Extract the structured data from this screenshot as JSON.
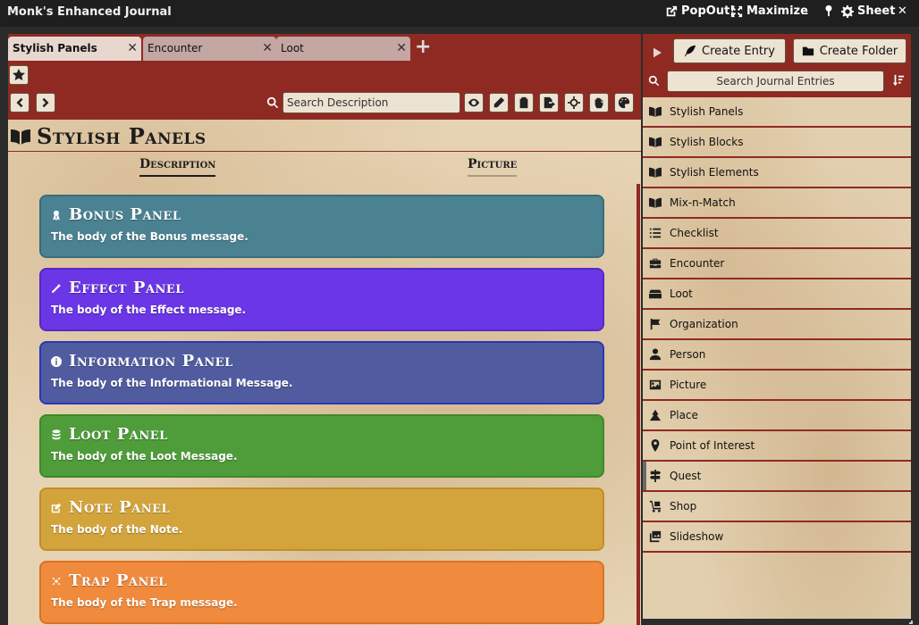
{
  "window": {
    "title": "Monk's Enhanced Journal",
    "buttons": {
      "popout": "PopOut!",
      "maximize": "Maximize",
      "minimize": "_",
      "sheet": "Sheet",
      "close": "✕"
    }
  },
  "tabs": [
    {
      "label": "Stylish Panels",
      "active": true
    },
    {
      "label": "Encounter",
      "active": false
    },
    {
      "label": "Loot",
      "active": false
    }
  ],
  "search": {
    "placeholder": "Search Description"
  },
  "entry": {
    "title": "Stylish Panels"
  },
  "subtabs": {
    "description": "Description",
    "picture": "Picture"
  },
  "panels": [
    {
      "title": "Bonus Panel",
      "body": "The body of the Bonus message.",
      "color": "#4a8292",
      "border": "#396d7a",
      "icon": "award-icon"
    },
    {
      "title": "Effect Panel",
      "body": "The body of the Effect message.",
      "color": "#6a36e6",
      "border": "#5529c7",
      "icon": "magic-wand-icon"
    },
    {
      "title": "Information Panel",
      "body": "The body of the Informational Message.",
      "color": "#515ca0",
      "border": "#2a36b8",
      "icon": "info-icon"
    },
    {
      "title": "Loot Panel",
      "body": "The body of the Loot Message.",
      "color": "#4f9c3a",
      "border": "#3d8a2a",
      "icon": "coins-icon"
    },
    {
      "title": "Note Panel",
      "body": "The body of the Note.",
      "color": "#d4a43c",
      "border": "#c08e26",
      "icon": "note-icon"
    },
    {
      "title": "Trap Panel",
      "body": "The body of the Trap message.",
      "color": "#f08a3c",
      "border": "#db7224",
      "icon": "crosshair-x-icon"
    }
  ],
  "sidebar": {
    "create_entry": "Create Entry",
    "create_folder": "Create Folder",
    "search_placeholder": "Search Journal Entries",
    "items": [
      {
        "label": "Stylish Panels",
        "icon": "book-open-icon"
      },
      {
        "label": "Stylish Blocks",
        "icon": "book-open-icon"
      },
      {
        "label": "Stylish Elements",
        "icon": "book-open-icon"
      },
      {
        "label": "Mix-n-Match",
        "icon": "book-open-icon"
      },
      {
        "label": "Checklist",
        "icon": "list-icon"
      },
      {
        "label": "Encounter",
        "icon": "toolbox-icon"
      },
      {
        "label": "Loot",
        "icon": "treasure-chest-icon"
      },
      {
        "label": "Organization",
        "icon": "flag-icon"
      },
      {
        "label": "Person",
        "icon": "person-icon"
      },
      {
        "label": "Picture",
        "icon": "image-icon"
      },
      {
        "label": "Place",
        "icon": "place-icon"
      },
      {
        "label": "Point of Interest",
        "icon": "map-marker-icon"
      },
      {
        "label": "Quest",
        "icon": "signpost-icon"
      },
      {
        "label": "Shop",
        "icon": "dolly-icon"
      },
      {
        "label": "Slideshow",
        "icon": "images-icon"
      }
    ]
  }
}
